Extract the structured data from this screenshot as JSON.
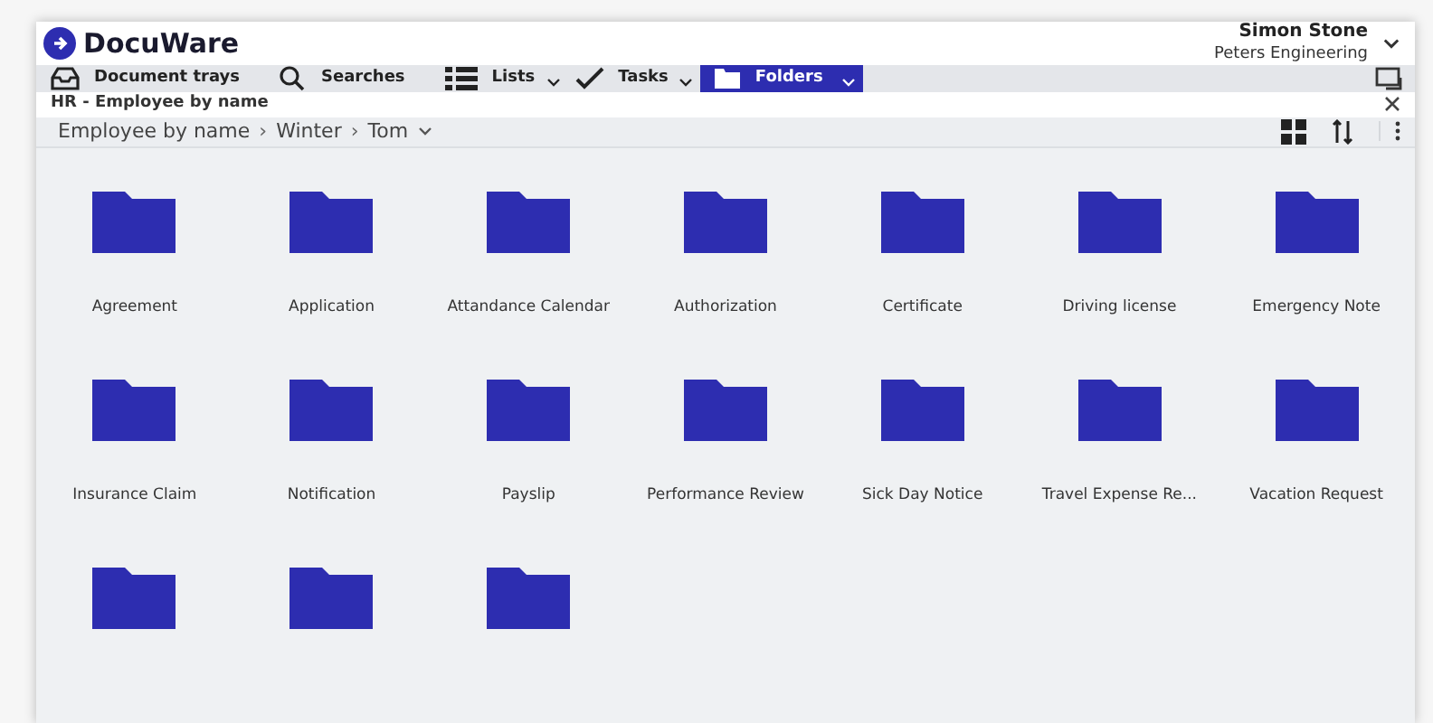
{
  "header": {
    "logo": "DocuWare",
    "user_name": "Simon Stone",
    "company": "Peters Engineering"
  },
  "nav_tabs": [
    {
      "label": "Document trays",
      "kind": "tray",
      "dropdown": false,
      "selected": false
    },
    {
      "label": "Searches",
      "kind": "search",
      "dropdown": false,
      "selected": false
    },
    {
      "label": "Lists",
      "kind": "list",
      "dropdown": true,
      "selected": false
    },
    {
      "label": "Tasks",
      "kind": "check",
      "dropdown": true,
      "selected": false
    },
    {
      "label": "Folders",
      "kind": "folder",
      "dropdown": true,
      "selected": true
    }
  ],
  "panel_title": "HR - Employee by name",
  "breadcrumb": [
    {
      "label": "Employee by name"
    },
    {
      "separator": "›",
      "label": "Winter"
    },
    {
      "separator": "›",
      "label": "Tom"
    }
  ],
  "folders": [
    {
      "kind": "named",
      "label": "Agreement"
    },
    {
      "kind": "named",
      "label": "Application"
    },
    {
      "kind": "named",
      "label": "Attandance Calendar"
    },
    {
      "kind": "named",
      "label": "Authorization"
    },
    {
      "kind": "named",
      "label": "Certificate"
    },
    {
      "kind": "named",
      "label": "Driving license"
    },
    {
      "kind": "named",
      "label": "Emergency Note"
    },
    {
      "kind": "named",
      "label": "Insurance Claim"
    },
    {
      "kind": "named",
      "label": "Notification"
    },
    {
      "kind": "named",
      "label": "Payslip"
    },
    {
      "kind": "named",
      "label": "Performance Review"
    },
    {
      "kind": "named",
      "label": "Sick Day Notice"
    },
    {
      "kind": "named",
      "label": "Travel Expense Re..."
    },
    {
      "kind": "named",
      "label": "Vacation Request"
    },
    {
      "kind": "cut"
    },
    {
      "kind": "cut"
    },
    {
      "kind": "cut"
    }
  ]
}
